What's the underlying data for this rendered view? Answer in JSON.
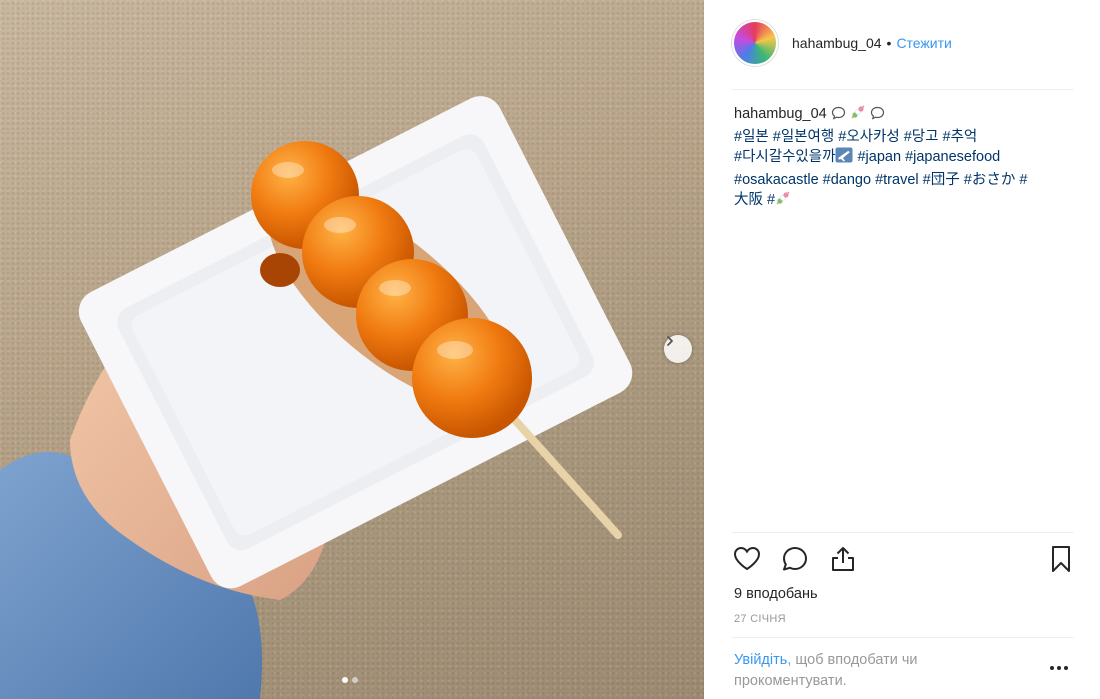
{
  "post": {
    "username": "hahambug_04",
    "separator": "•",
    "follow_label": "Стежити",
    "caption": {
      "username": "hahambug_04",
      "tags": [
        "#일본",
        "#일본여행",
        "#오사카성",
        "#당고",
        "#추억",
        "#다시갈수있을까",
        "#japan",
        "#japanesefood",
        "#osakacastle",
        "#dango",
        "#travel",
        "#団子",
        "#おさか",
        "#",
        "大阪",
        "#"
      ]
    },
    "likes_label": "9 вподобань",
    "date_label": "27 СІЧНЯ",
    "login_prompt": {
      "link": "Увійдіть",
      "rest": ", щоб вподобати чи прокоментувати."
    }
  },
  "carousel": {
    "total": 2,
    "current": 1
  },
  "icons": {
    "like": "heart-icon",
    "comment": "comment-icon",
    "share": "share-icon",
    "save": "bookmark-icon",
    "next": "chevron-right-icon",
    "more": "more-options-icon"
  },
  "colors": {
    "link_blue": "#3897f0",
    "hashtag": "#003569",
    "muted": "#999999"
  }
}
